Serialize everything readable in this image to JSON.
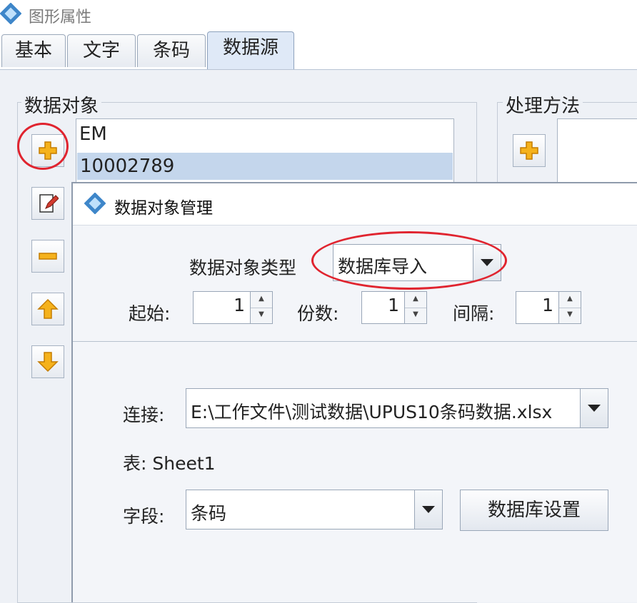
{
  "window": {
    "title": "图形属性",
    "tabs": [
      {
        "label": "基本"
      },
      {
        "label": "文字"
      },
      {
        "label": "条码"
      },
      {
        "label": "数据源",
        "active": true
      }
    ]
  },
  "data_objects": {
    "legend": "数据对象",
    "items": [
      "EM",
      "10002789"
    ],
    "selected_index": 1
  },
  "processing": {
    "legend": "处理方法"
  },
  "dialog": {
    "title": "数据对象管理",
    "type_label": "数据对象类型",
    "type_value": "数据库导入",
    "start_label": "起始:",
    "start_value": "1",
    "copies_label": "份数:",
    "copies_value": "1",
    "interval_label": "间隔:",
    "interval_value": "1",
    "connection_label": "连接:",
    "connection_value": "E:\\工作文件\\测试数据\\UPUS10条码数据.xlsx",
    "table_text": "表: Sheet1",
    "field_label": "字段:",
    "field_value": "条码",
    "db_settings_label": "数据库设置"
  },
  "colors": {
    "highlight_ring": "#e0242f",
    "selection": "#c4d6ec"
  }
}
